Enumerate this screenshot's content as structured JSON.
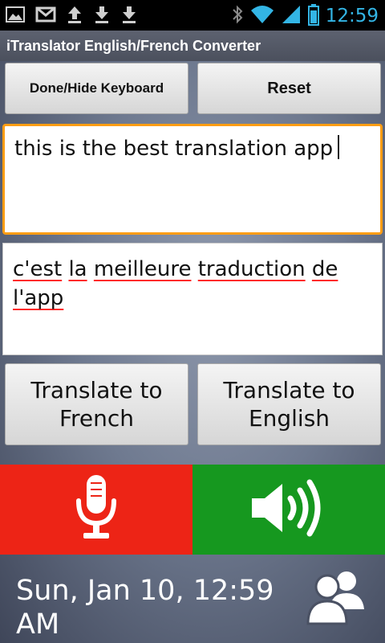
{
  "status_bar": {
    "time": "12:59",
    "notification_icons": [
      "image-icon",
      "gmail-icon",
      "upload-icon",
      "download-icon",
      "download-icon"
    ],
    "system_icons": [
      "bluetooth-icon",
      "wifi-icon",
      "signal-icon",
      "battery-icon"
    ],
    "accent_color": "#33b5e5"
  },
  "app": {
    "title": "iTranslator English/French Converter"
  },
  "toolbar": {
    "done_label": "Done/Hide Keyboard",
    "reset_label": "Reset"
  },
  "input": {
    "value": "this is the best translation app"
  },
  "output": {
    "words": [
      "c'est",
      "la",
      "meilleure",
      "traduction",
      "de",
      "l'app"
    ]
  },
  "actions": {
    "to_french_line1": "Translate to",
    "to_french_line2": "French",
    "to_english_line1": "Translate to",
    "to_english_line2": "English"
  },
  "controls": {
    "mic_icon": "microphone-icon",
    "speaker_icon": "speaker-icon",
    "mic_color": "#ed2416",
    "speaker_color": "#16981f"
  },
  "footer": {
    "datetime_line1": "Sun, Jan 10, 12:59",
    "datetime_line2": "AM",
    "users_icon": "users-icon"
  }
}
